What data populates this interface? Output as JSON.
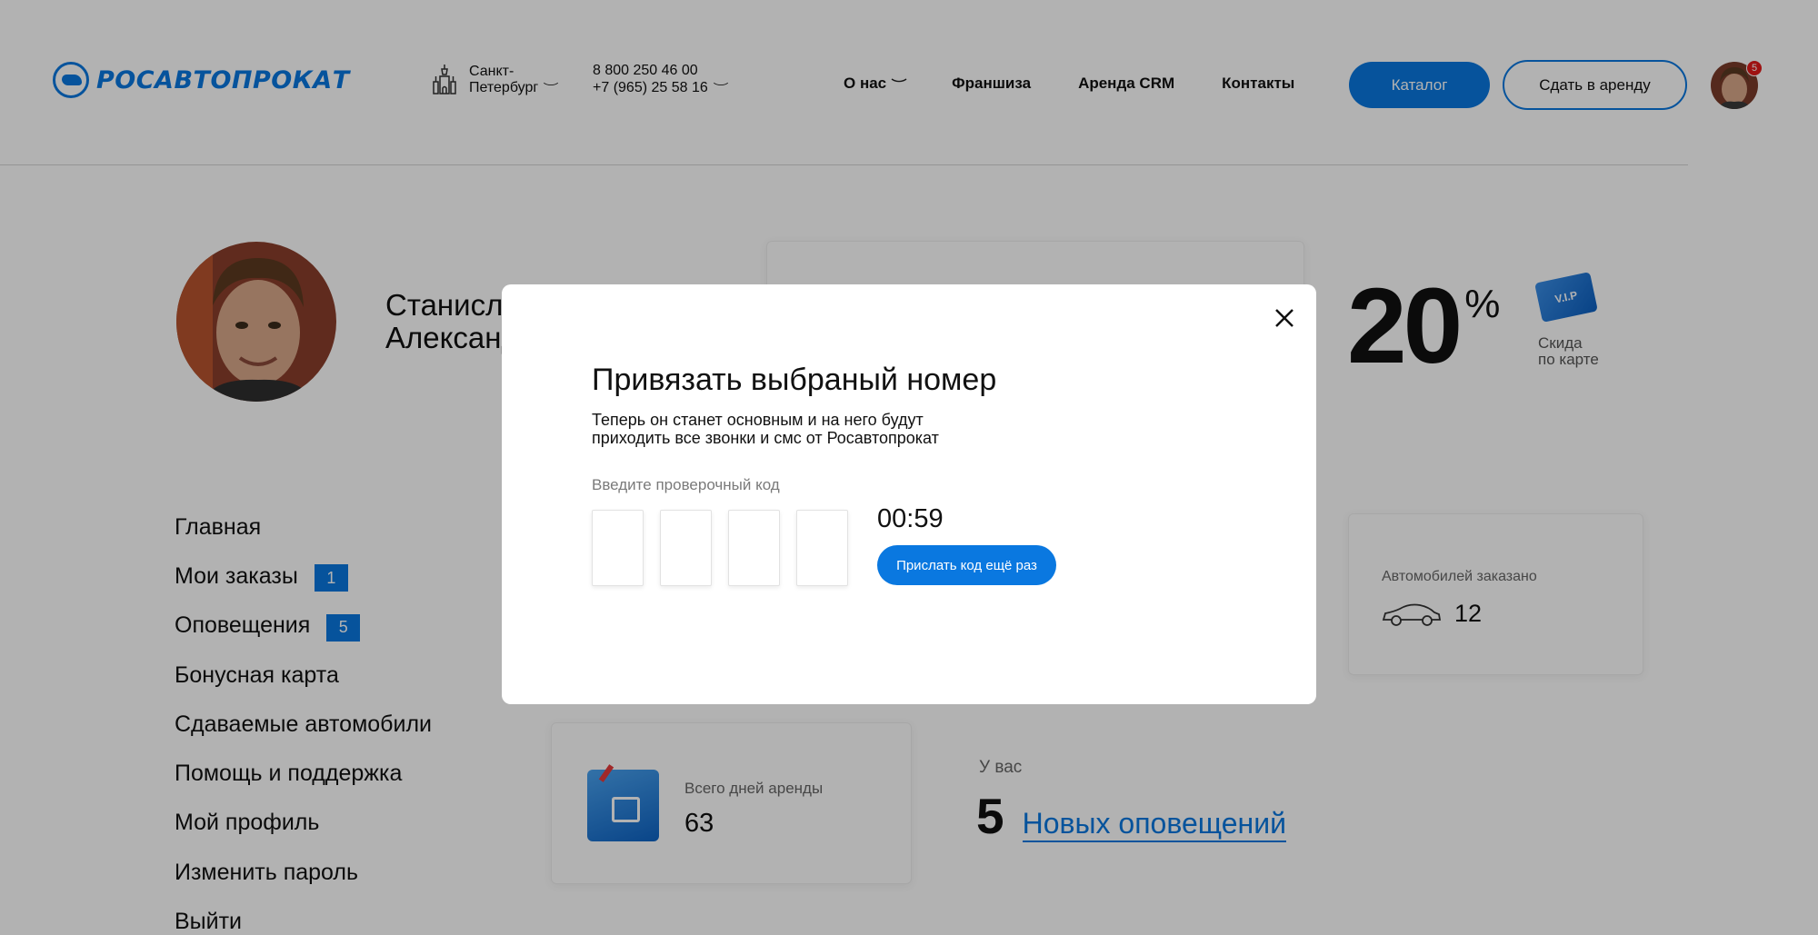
{
  "header": {
    "logo_text": "РОСАВТОПРОКАТ",
    "city_line1": "Санкт-",
    "city_line2": "Петербург",
    "phone1": "8 800 250 46 00",
    "phone2": "+7 (965) 25 58 16",
    "nav": [
      "О нас",
      "Франшиза",
      "Аренда CRM",
      "Контакты"
    ],
    "catalog_label": "Каталог",
    "rent_label": "Сдать в аренду",
    "avatar_badge": "5"
  },
  "profile": {
    "name_line1": "Станислав",
    "name_line2": "Александров"
  },
  "menu": [
    {
      "label": "Главная",
      "badge": ""
    },
    {
      "label": "Мои заказы",
      "badge": "1"
    },
    {
      "label": "Оповещения",
      "badge": "5"
    },
    {
      "label": "Бонусная карта",
      "badge": ""
    },
    {
      "label": "Сдаваемые автомобили",
      "badge": ""
    },
    {
      "label": "Помощь и поддержка",
      "badge": ""
    },
    {
      "label": "Мой профиль",
      "badge": ""
    },
    {
      "label": "Изменить пароль",
      "badge": ""
    },
    {
      "label": "Выйти",
      "badge": ""
    }
  ],
  "discount": {
    "value": "20",
    "unit": "%",
    "card_text": "V.I.P",
    "label_line1": "Скида",
    "label_line2": "по карте"
  },
  "cars": {
    "label": "Автомобилей заказано",
    "value": "12"
  },
  "days": {
    "label": "Всего дней аренды",
    "value": "63"
  },
  "notifications": {
    "label": "У вас",
    "count": "5",
    "link": "Новых оповещений"
  },
  "modal": {
    "title": "Привязать выбраный номер",
    "desc_line1": "Теперь он станет основным и на него будут",
    "desc_line2": "приходить все звонки и смс от Росавтопрокат",
    "code_label": "Введите проверочный код",
    "timer": "00:59",
    "resend_label": "Прислать код ещё раз"
  },
  "colors": {
    "accent": "#0a78e0",
    "badge_red": "#e21b1b"
  }
}
